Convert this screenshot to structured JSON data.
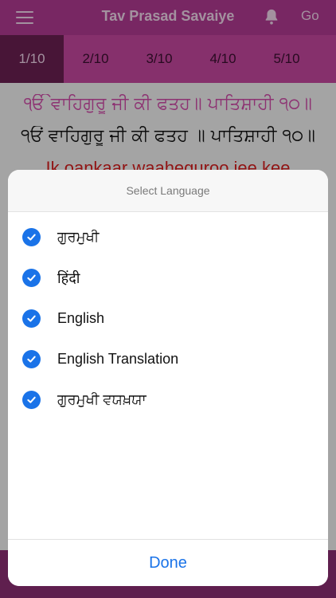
{
  "nav": {
    "title": "Tav Prasad Savaiye",
    "go_label": "Go",
    "menu_icon": "hamburger-icon",
    "bell_icon": "bell-icon"
  },
  "tabs": [
    {
      "label": "1/10",
      "active": true
    },
    {
      "label": "2/10",
      "active": false
    },
    {
      "label": "3/10",
      "active": false
    },
    {
      "label": "4/10",
      "active": false
    },
    {
      "label": "5/10",
      "active": false
    }
  ],
  "content": {
    "gurmukhi_line": "ੴ ਵਾਹਿਗੁਰੂ ਜੀ ਕੀ ਫਤਹ॥ ਪਾਤਿਸ਼ਾਹੀ ੧੦॥",
    "hindi_line": "੧ਓਂ ਵਾਹਿਗੁਰੂ ਜੀ ਕੀ ਫਤਹ ॥ ਪਾਤਿਸ਼ਾਹੀ ੧੦॥",
    "english_line": "Ik oankaar waaheguroo jee kee"
  },
  "dialog": {
    "title": "Select Language",
    "options": [
      {
        "label": "ਗੁਰਮੁਖੀ",
        "checked": true
      },
      {
        "label": "हिंदी",
        "checked": true
      },
      {
        "label": "English",
        "checked": true
      },
      {
        "label": "English Translation",
        "checked": true
      },
      {
        "label": "ਗੁਰਮੁਖੀ ਵਯਖ਼ਯਾ",
        "checked": true
      }
    ],
    "done_label": "Done"
  },
  "colors": {
    "nav_bg": "#b13a92",
    "tab_bg": "#c6479f",
    "tab_active_bg": "#6a1f52",
    "accent_blue": "#1a73e8",
    "gurmukhi_pink": "#d04aa8",
    "english_red": "#d61f1f"
  }
}
